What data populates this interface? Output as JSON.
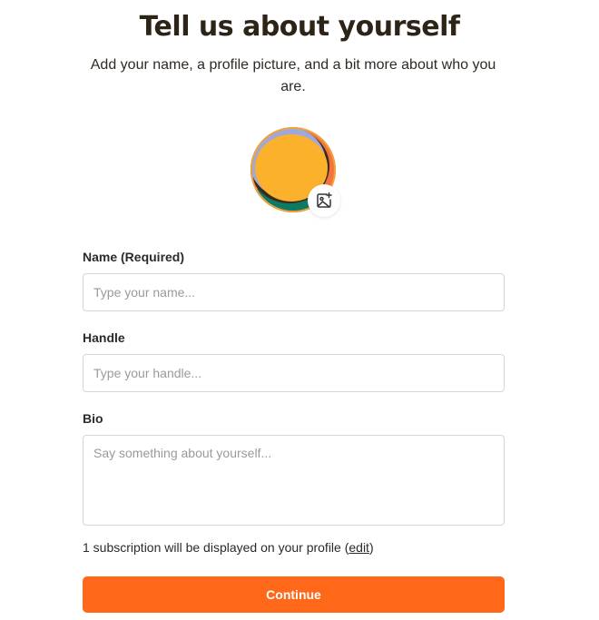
{
  "header": {
    "title": "Tell us about yourself",
    "subtitle": "Add your name, a profile picture, and a bit more about who you are."
  },
  "avatar": {
    "edit_icon": "image-add-icon",
    "colors": {
      "orange": "#f2743a",
      "yellow": "#fbb12b",
      "lavender": "#9da8dc",
      "teal": "#0f7a63",
      "dark": "#3a2a1a"
    }
  },
  "form": {
    "name_label": "Name (Required)",
    "name_placeholder": "Type your name...",
    "handle_label": "Handle",
    "handle_placeholder": "Type your handle...",
    "bio_label": "Bio",
    "bio_placeholder": "Say something about yourself..."
  },
  "subscriptions": {
    "text_prefix": "1 subscription will be displayed on your profile (",
    "edit_link": "edit",
    "text_suffix": ")"
  },
  "actions": {
    "continue_label": "Continue",
    "accent_color": "#ff6719"
  }
}
